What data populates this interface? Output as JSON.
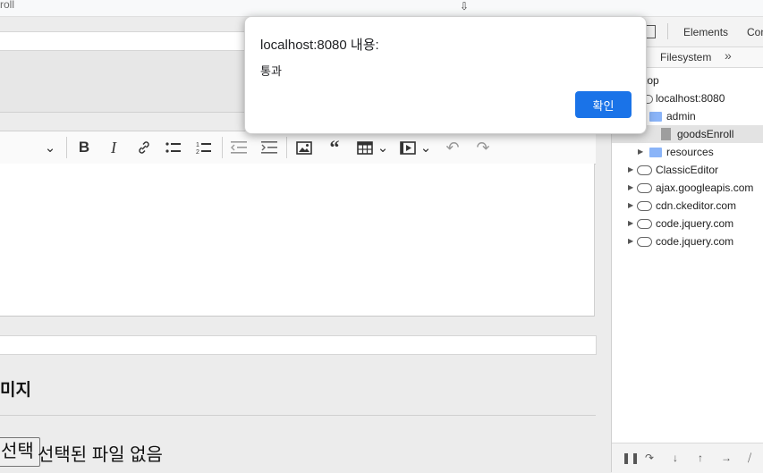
{
  "browser": {
    "tab_fragment": "roll"
  },
  "editor_toolbar": {
    "items": [
      "heading-dropdown",
      "bold",
      "italic",
      "link",
      "bulleted-list",
      "numbered-list",
      "outdent",
      "indent",
      "image",
      "blockquote",
      "table",
      "media",
      "undo",
      "redo"
    ]
  },
  "form": {
    "section_title": "미지",
    "file_button_label": "선택",
    "file_status": "선택된 파일 없음"
  },
  "devtools": {
    "tabs": [
      "Elements",
      "Con"
    ],
    "subtab": "Filesystem",
    "tree": [
      {
        "label": "top",
        "level": 0,
        "type": "frame"
      },
      {
        "label": "localhost:8080",
        "level": 1,
        "type": "cloud"
      },
      {
        "label": "admin",
        "level": 2,
        "type": "folder"
      },
      {
        "label": "goodsEnroll",
        "level": 3,
        "type": "file",
        "selected": true
      },
      {
        "label": "resources",
        "level": 2,
        "type": "folder"
      },
      {
        "label": "ClassicEditor",
        "level": 0,
        "type": "cloud"
      },
      {
        "label": "ajax.googleapis.com",
        "level": 0,
        "type": "cloud"
      },
      {
        "label": "cdn.ckeditor.com",
        "level": 0,
        "type": "cloud"
      },
      {
        "label": "code.jquery.com",
        "level": 0,
        "type": "cloud"
      },
      {
        "label": "code.jquery.com",
        "level": 0,
        "type": "cloud"
      }
    ]
  },
  "dialog": {
    "title": "localhost:8080 내용:",
    "message": "통과",
    "ok_label": "확인"
  },
  "colors": {
    "accent": "#1a73e8",
    "folder": "#8ab4f8"
  }
}
